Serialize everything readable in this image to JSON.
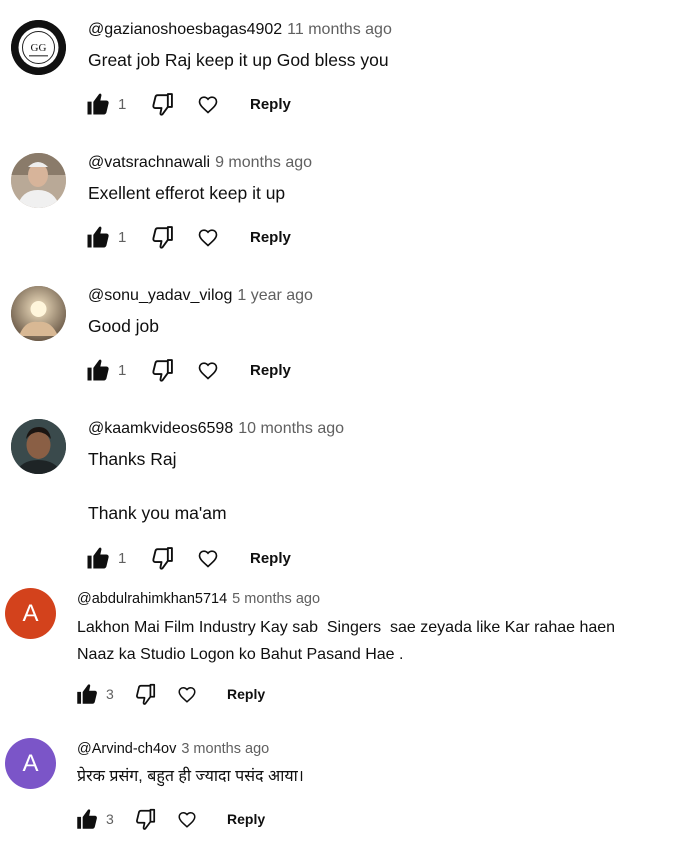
{
  "comments": [
    {
      "author": "@gazianoshoesbagas4902",
      "time": "11 months ago",
      "text": "Great job Raj keep it up God bless you",
      "likes": "1",
      "reply_label": "Reply",
      "avatar_icon": "gg-logo-avatar"
    },
    {
      "author": "@vatsrachnawali",
      "time": "9 months ago",
      "text": "Exellent efferot keep it up",
      "likes": "1",
      "reply_label": "Reply",
      "avatar_icon": "person-photo-avatar"
    },
    {
      "author": "@sonu_yadav_vilog",
      "time": "1 year ago",
      "text": "Good job",
      "likes": "1",
      "reply_label": "Reply",
      "avatar_icon": "hands-photo-avatar"
    },
    {
      "author": "@kaamkvideos6598",
      "time": "10 months ago",
      "text": "Thanks Raj\n\nThank you ma'am",
      "likes": "1",
      "reply_label": "Reply",
      "avatar_icon": "person-photo-avatar"
    },
    {
      "author": "@abdulrahimkhan5714",
      "time": "5 months ago",
      "text": "Lakhon Mai Film Industry Kay sab  Singers  sae zeyada like Kar rahae haen\nNaaz ka Studio Logon ko Bahut Pasand Hae .",
      "likes": "3",
      "reply_label": "Reply",
      "avatar_letter": "A",
      "avatar_color": "#d3421c"
    },
    {
      "author": "@Arvind-ch4ov",
      "time": "3 months ago",
      "text": "प्रेरक प्रसंग, बहुत ही ज्यादा पसंद आया।",
      "likes": "3",
      "reply_label": "Reply",
      "avatar_letter": "A",
      "avatar_color": "#7b55c8"
    }
  ],
  "colors": {
    "text_primary": "#0f0f0f",
    "text_secondary": "#606060",
    "background": "#ffffff"
  }
}
